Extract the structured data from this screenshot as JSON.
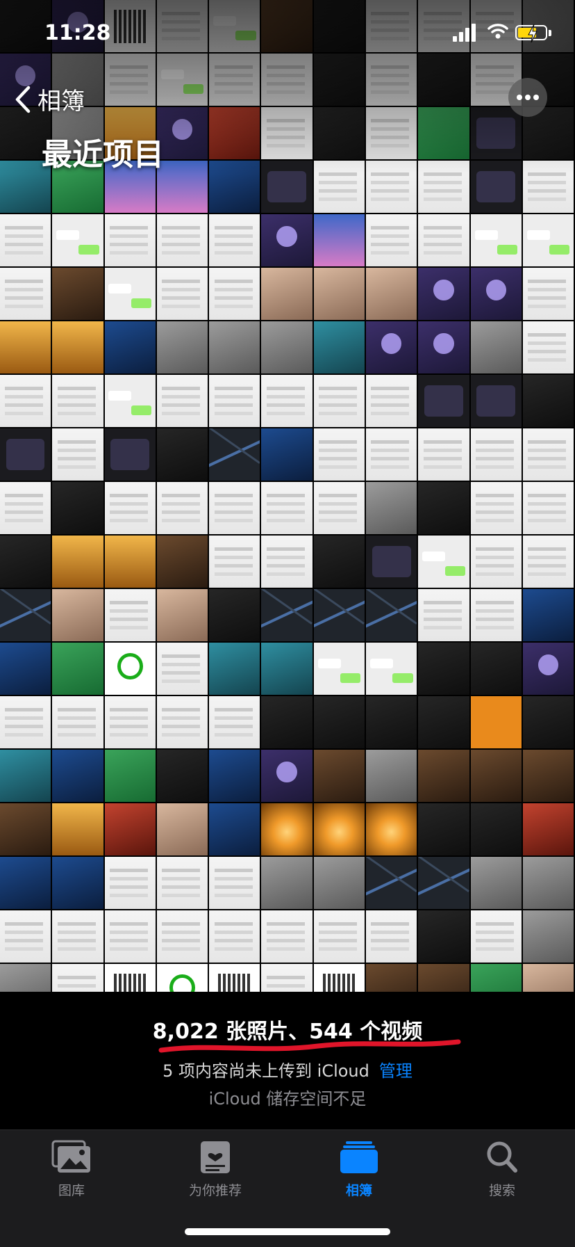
{
  "status_bar": {
    "time": "11:28"
  },
  "navigation": {
    "back_label": "相簿",
    "title": "最近项目"
  },
  "library_grid": {
    "rows": 19,
    "tiles": [
      "dark",
      "purple",
      "qr",
      "light",
      "chat",
      "brown",
      "dark",
      "light",
      "light",
      "light",
      "gray",
      "purple",
      "gray",
      "light",
      "chat",
      "light",
      "light",
      "dark",
      "light",
      "dark",
      "light",
      "dark",
      "dark",
      "gray",
      "gold",
      "purple",
      "red",
      "light",
      "dark",
      "light",
      "green",
      "darkui",
      "dark",
      "teal",
      "green",
      "sky",
      "sky",
      "blue",
      "darkui",
      "light",
      "light",
      "light",
      "darkui",
      "light",
      "light",
      "chat",
      "light",
      "light",
      "light",
      "purple",
      "sky",
      "light",
      "light",
      "chat",
      "chat",
      "light",
      "brown",
      "chat",
      "light",
      "light",
      "skin",
      "skin",
      "skin",
      "purple",
      "purple",
      "light",
      "gold",
      "gold",
      "blue",
      "gray",
      "gray",
      "gray",
      "teal",
      "purple",
      "purple",
      "gray",
      "light",
      "light",
      "light",
      "chat",
      "light",
      "light",
      "light",
      "light",
      "light",
      "darkui",
      "darkui",
      "dark",
      "darkui",
      "light",
      "darkui",
      "dark",
      "map",
      "blue",
      "light",
      "light",
      "light",
      "light",
      "light",
      "light",
      "dark",
      "light",
      "light",
      "light",
      "light",
      "light",
      "gray",
      "dark",
      "light",
      "light",
      "dark",
      "gold",
      "gold",
      "brown",
      "light",
      "light",
      "dark",
      "darkui",
      "chat",
      "light",
      "light",
      "map",
      "skin",
      "light",
      "skin",
      "dark",
      "map",
      "map",
      "map",
      "light",
      "light",
      "blue",
      "blue",
      "green",
      "arrow",
      "light",
      "teal",
      "teal",
      "chat",
      "chat",
      "dark",
      "dark",
      "purple",
      "light",
      "light",
      "light",
      "light",
      "light",
      "dark",
      "dark",
      "dark",
      "dark",
      "orange",
      "dark",
      "teal",
      "blue",
      "green",
      "dark",
      "blue",
      "purple",
      "brown",
      "gray",
      "brown",
      "brown",
      "brown",
      "brown",
      "gold",
      "red",
      "skin",
      "blue",
      "sunset",
      "sunset",
      "sunset",
      "dark",
      "dark",
      "red",
      "blue",
      "blue",
      "light",
      "light",
      "light",
      "gray",
      "gray",
      "map",
      "map",
      "gray",
      "gray",
      "light",
      "light",
      "light",
      "light",
      "light",
      "light",
      "light",
      "light",
      "dark",
      "light",
      "gray",
      "gray",
      "light",
      "qr",
      "arrow",
      "qr",
      "light",
      "qr",
      "brown",
      "brown",
      "green",
      "skin"
    ]
  },
  "more_button": {
    "icon": "ellipsis-icon"
  },
  "summary": {
    "counts": "8,022 张照片、544 个视频",
    "upload_notice": "5 项内容尚未上传到 iCloud",
    "manage_link": "管理",
    "storage_notice": "iCloud 储存空间不足",
    "scribble_color": "#e0152a"
  },
  "tab_bar": {
    "items": [
      {
        "label": "图库",
        "icon": "photo-library-icon",
        "active": false
      },
      {
        "label": "为你推荐",
        "icon": "for-you-icon",
        "active": false
      },
      {
        "label": "相簿",
        "icon": "albums-icon",
        "active": true
      },
      {
        "label": "搜索",
        "icon": "search-icon",
        "active": false
      }
    ],
    "active_color": "#0a84ff",
    "inactive_color": "#8e8e93"
  }
}
